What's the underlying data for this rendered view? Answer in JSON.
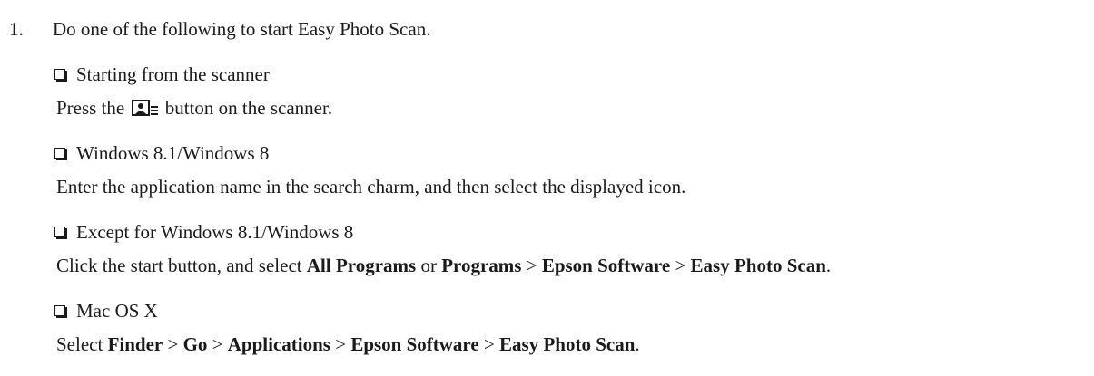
{
  "step": {
    "number": "1.",
    "text": "Do one of the following to start Easy Photo Scan."
  },
  "options": [
    {
      "heading": "Starting from the scanner",
      "body_prefix": "Press the ",
      "body_icon": "photo-scan-button-icon",
      "body_suffix": " button on the scanner."
    },
    {
      "heading": "Windows 8.1/Windows 8",
      "body": "Enter the application name in the search charm, and then select the displayed icon."
    },
    {
      "heading": "Except for Windows 8.1/Windows 8",
      "body_parts": [
        {
          "t": "Click the start button, and select ",
          "b": false
        },
        {
          "t": "All Programs",
          "b": true
        },
        {
          "t": " or ",
          "b": false
        },
        {
          "t": "Programs",
          "b": true
        },
        {
          "t": " > ",
          "b": false
        },
        {
          "t": "Epson Software",
          "b": true
        },
        {
          "t": " > ",
          "b": false
        },
        {
          "t": "Easy Photo Scan",
          "b": true
        },
        {
          "t": ".",
          "b": false
        }
      ]
    },
    {
      "heading": "Mac OS X",
      "body_parts": [
        {
          "t": "Select ",
          "b": false
        },
        {
          "t": "Finder",
          "b": true
        },
        {
          "t": " > ",
          "b": false
        },
        {
          "t": "Go",
          "b": true
        },
        {
          "t": " > ",
          "b": false
        },
        {
          "t": "Applications",
          "b": true
        },
        {
          "t": " > ",
          "b": false
        },
        {
          "t": "Epson Software",
          "b": true
        },
        {
          "t": " > ",
          "b": false
        },
        {
          "t": "Easy Photo Scan",
          "b": true
        },
        {
          "t": ".",
          "b": false
        }
      ]
    }
  ]
}
